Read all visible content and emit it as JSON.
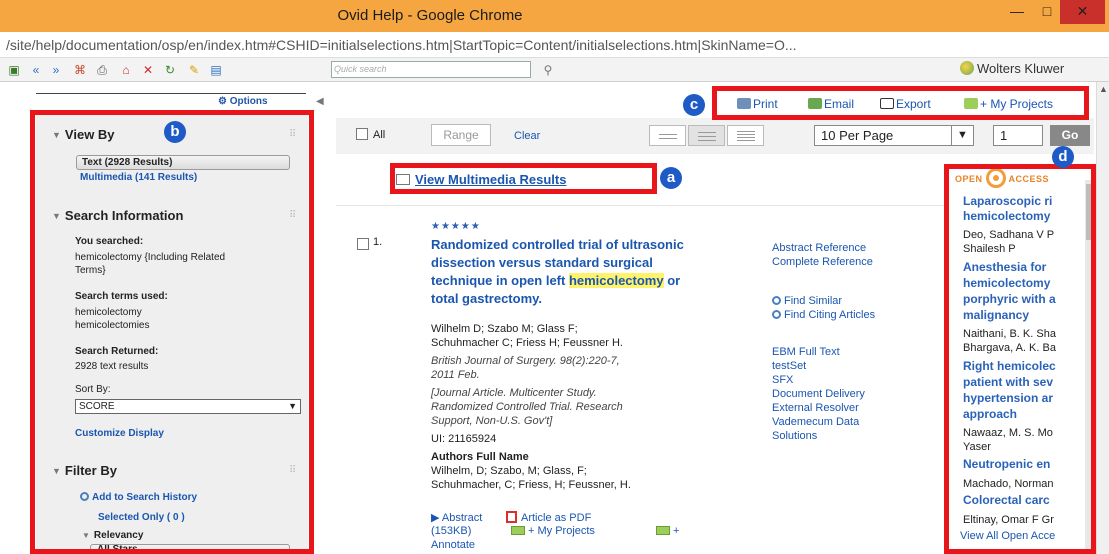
{
  "window": {
    "title": "Ovid Help - Google Chrome",
    "minimize": "—",
    "maximize": "□",
    "close": "✕",
    "url": "/site/help/documentation/osp/en/index.htm#CSHID=initialselections.htm|StartTopic=Content/initialselections.htm|SkinName=O..."
  },
  "help_toolbar": {
    "search_placeholder": "Quick search",
    "brand": "Wolters Kluwer",
    "icons": [
      "pane-icon",
      "back-icon",
      "forward-icon",
      "sync-icon",
      "print-icon",
      "home-icon",
      "stop-icon",
      "refresh-icon",
      "highlight-icon",
      "toc-icon",
      "search-go-icon"
    ]
  },
  "left": {
    "options": "Options",
    "view_by": {
      "heading": "View By",
      "text_results": "Text (2928 Results)",
      "multimedia_results": "Multimedia (141 Results)"
    },
    "search_info": {
      "heading": "Search Information",
      "you_searched_label": "You searched:",
      "you_searched_line1": "hemicolectomy {Including Related",
      "you_searched_line2": "Terms}",
      "terms_label": "Search terms used:",
      "term1": "hemicolectomy",
      "term2": "hemicolectomies",
      "returned_label": "Search Returned:",
      "returned_value": "2928 text results",
      "sort_label": "Sort By:",
      "sort_value": "SCORE",
      "customize": "Customize Display"
    },
    "filter_by": {
      "heading": "Filter By",
      "add_history": "Add to Search History",
      "selected_only": "Selected Only ( 0 )",
      "relevancy": "Relevancy",
      "all_stars": "All Stars"
    }
  },
  "actions": {
    "print": "Print",
    "email": "Email",
    "export": "Export",
    "my_projects": "+ My Projects"
  },
  "badges": {
    "a": "a",
    "b": "b",
    "c": "c",
    "d": "d"
  },
  "controls": {
    "all": "All",
    "range": "Range",
    "clear": "Clear",
    "per_page": "10 Per Page",
    "page": "1",
    "go": "Go"
  },
  "view_multimedia": "View Multimedia Results",
  "result": {
    "stars": "★★★★★",
    "number": "1.",
    "title_part1": "Randomized controlled trial of ultrasonic dissection versus standard surgical technique in open left ",
    "title_highlight": "hemicolectomy",
    "title_part2": " or total gastrectomy.",
    "authors_line1": "Wilhelm D; Szabo M; Glass F;",
    "authors_line2": "Schuhmacher C; Friess H; Feussner H.",
    "source_line1": "British Journal of Surgery. 98(2):220-7,",
    "source_line2": "2011 Feb.",
    "type_line1": "[Journal Article. Multicenter Study.",
    "type_line2": "Randomized Controlled Trial. Research",
    "type_line3": "Support, Non-U.S. Gov't]",
    "ui": "UI: 21165924",
    "authors_full_label": "Authors Full Name",
    "authors_full_line1": "Wilhelm, D; Szabo, M; Glass, F;",
    "authors_full_line2": "Schuhmacher, C; Friess, H; Feussner, H.",
    "links": {
      "abstract_ref": "Abstract Reference",
      "complete_ref": "Complete Reference",
      "find_similar": "Find Similar",
      "find_citing": "Find Citing Articles",
      "ebm": "EBM Full Text",
      "testset": "testSet",
      "sfx": "SFX",
      "doc_delivery": "Document Delivery",
      "ext_resolver": "External Resolver",
      "vademecum1": "Vademecum Data",
      "vademecum2": "Solutions"
    },
    "bottom": {
      "abstract": "▶ Abstract",
      "size": "(153KB)",
      "pdf": "Article as PDF",
      "projects": "+ My Projects",
      "annotate_plus": "+",
      "annotate": "Annotate"
    }
  },
  "open_access": {
    "header_left": "OPEN",
    "header_right": "ACCESS",
    "items": [
      {
        "t1": "Laparoscopic ri",
        "t2": "hemicolectomy",
        "a1": "Deo, Sadhana V P",
        "a2": "Shailesh P"
      },
      {
        "t1": "Anesthesia for",
        "t2": "hemicolectomy",
        "t3": "porphyric with a",
        "t4": "malignancy",
        "a1": "Naithani, B. K. Sha",
        "a2": "Bhargava, A. K. Ba"
      },
      {
        "t1": "Right hemicolec",
        "t2": "patient with sev",
        "t3": "hypertension ar",
        "t4": "approach",
        "a1": "Nawaaz, M. S. Mo",
        "a2": "Yaser"
      },
      {
        "t1": "Neutropenic en",
        "a1": "Machado, Norman"
      },
      {
        "t1": "Colorectal carc",
        "a1": "Eltinay, Omar F Gr"
      }
    ],
    "view_all": "View All Open Acce"
  }
}
